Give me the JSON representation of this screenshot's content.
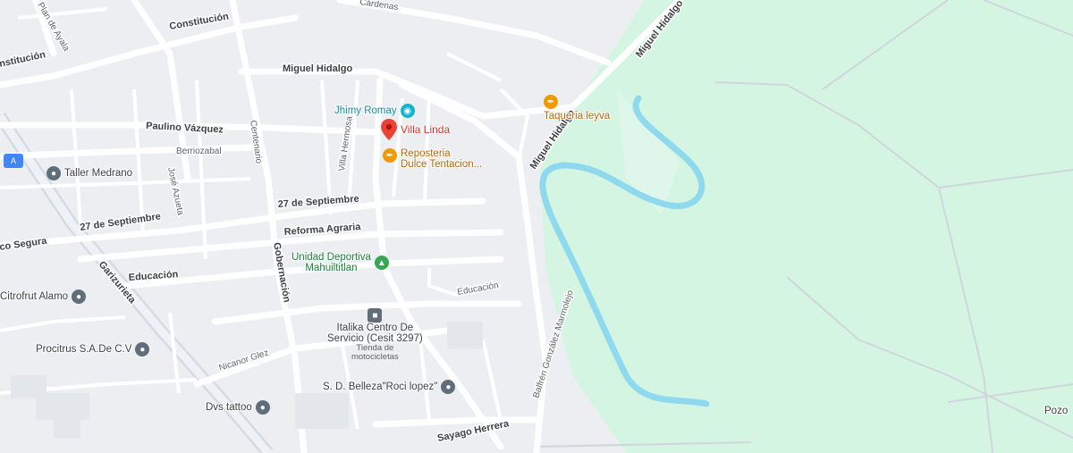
{
  "colors": {
    "land": "#eceef1",
    "park": "#d4f5e2",
    "river": "#8fd9ef",
    "road": "#ffffff",
    "major_road": "#d5dbe3",
    "pin": "#ea4335"
  },
  "streets": {
    "constitucion_top": "Constitución",
    "constitucion_left": "nstitución",
    "plan_de_ayala": "Plan de Ayala",
    "miguel_hidalgo_top": "Miguel Hidalgo",
    "miguel_hidalgo_ne": "Miguel Hidalgo",
    "miguel_hidalgo_diag": "Miguel Hidalgo",
    "paulino_vazquez": "Paulino Vázquez",
    "berriozabal": "Berriozabal",
    "centenario": "Centenario",
    "villa_hermosa": "Villa Hermosa",
    "jose_azueta": "José Azueta",
    "septiembre_left": "27 de Septiembre",
    "septiembre_mid": "27 de Septiembre",
    "reforma_agraria": "Reforma Agraria",
    "co_segura": "co Segura",
    "educacion_left": "Educación",
    "educacion_right": "Educación",
    "gobernacion": "Gobernación",
    "garizurieta": "Garizurieta",
    "nicanor_glez": "Nicanor Glez",
    "sayago_herrera": "Sayago Herrera",
    "balfren": "Balfrén González Marmolejo",
    "cardenas": "Cárdenas"
  },
  "places": {
    "villa_linda": "Villa Linda",
    "jhimy_romay": "Jhimy Romay",
    "reposteria_1": "Reposteria",
    "reposteria_2": "Dulce Tentacion...",
    "taqueria": "Taqueria leyva",
    "taller": "Taller Medrano",
    "unidad_1": "Unidad Deportiva",
    "unidad_2": "Mahuiltitlan",
    "citrofrut": "Citrofrut Alamo",
    "italika_1": "Italika Centro De",
    "italika_2": "Servicio (Cesit 3297)",
    "italika_sub_1": "Tienda de",
    "italika_sub_2": "motocicletas",
    "procitrus": "Procitrus S.A.De C.V",
    "belleza": "S. D. Belleza\"Roci lopez\"",
    "dvs": "Dvs tattoo",
    "pozo": "Pozo"
  },
  "icons": {
    "villa_linda": "red-pin-icon",
    "jhimy_romay": "store-icon",
    "reposteria": "restaurant-icon",
    "taqueria": "restaurant-icon",
    "taller": "place-icon",
    "unidad": "park-icon",
    "citrofrut": "place-icon",
    "italika": "shop-icon",
    "procitrus": "place-icon",
    "belleza": "place-icon",
    "dvs": "place-icon",
    "badge": "transit-icon"
  },
  "badge_text": "A"
}
